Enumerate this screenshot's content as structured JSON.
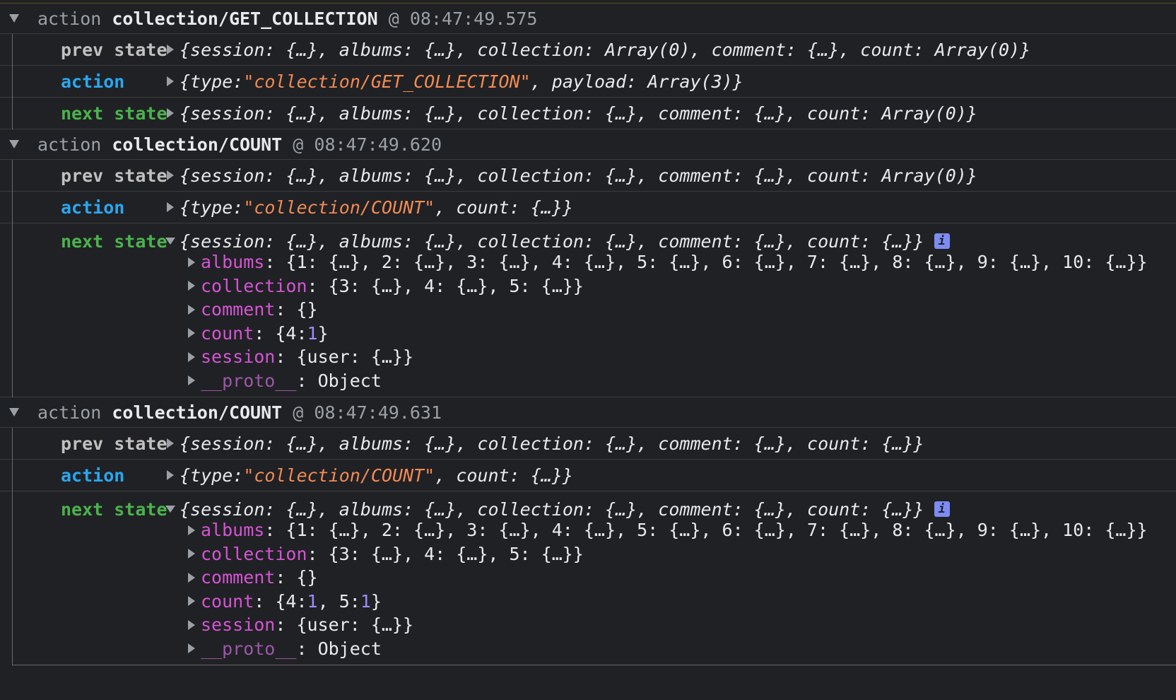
{
  "groups": [
    {
      "action_word": "action",
      "type": "collection/GET_COLLECTION",
      "at": "@",
      "time": "08:47:49.575",
      "prev_label": "prev state",
      "prev_value": "{session: {…}, albums: {…}, collection: Array(0), comment: {…}, count: Array(0)}",
      "action_label": "action",
      "action_value": {
        "pre": "{type: ",
        "str": "\"collection/GET_COLLECTION\"",
        "post": ", payload: Array(3)}"
      },
      "next_label": "next state",
      "next_value": "{session: {…}, albums: {…}, collection: {…}, comment: {…}, count: Array(0)}"
    },
    {
      "action_word": "action",
      "type": "collection/COUNT",
      "at": "@",
      "time": "08:47:49.620",
      "prev_label": "prev state",
      "prev_value": "{session: {…}, albums: {…}, collection: {…}, comment: {…}, count: Array(0)}",
      "action_label": "action",
      "action_value": {
        "pre": "{type: ",
        "str": "\"collection/COUNT\"",
        "post": ", count: {…}}"
      },
      "next_label": "next state",
      "next_value": "{session: {…}, albums: {…}, collection: {…}, comment: {…}, count: {…}}",
      "info_glyph": "i",
      "props": {
        "albums_key": "albums",
        "albums_val": ": {1: {…}, 2: {…}, 3: {…}, 4: {…}, 5: {…}, 6: {…}, 7: {…}, 8: {…}, 9: {…}, 10: {…}}",
        "collection_key": "collection",
        "collection_val": ": {3: {…}, 4: {…}, 5: {…}}",
        "comment_key": "comment",
        "comment_val": ": {}",
        "count_key": "count",
        "count_pre": ": {4: ",
        "count_n1": "1",
        "count_mid": "",
        "count_n2": "",
        "count_post": "}",
        "session_key": "session",
        "session_val": ": {user: {…}}",
        "proto_key": "__proto__",
        "proto_val": ": Object"
      }
    },
    {
      "action_word": "action",
      "type": "collection/COUNT",
      "at": "@",
      "time": "08:47:49.631",
      "prev_label": "prev state",
      "prev_value": "{session: {…}, albums: {…}, collection: {…}, comment: {…}, count: {…}}",
      "action_label": "action",
      "action_value": {
        "pre": "{type: ",
        "str": "\"collection/COUNT\"",
        "post": ", count: {…}}"
      },
      "next_label": "next state",
      "next_value": "{session: {…}, albums: {…}, collection: {…}, comment: {…}, count: {…}}",
      "info_glyph": "i",
      "props": {
        "albums_key": "albums",
        "albums_val": ": {1: {…}, 2: {…}, 3: {…}, 4: {…}, 5: {…}, 6: {…}, 7: {…}, 8: {…}, 9: {…}, 10: {…}}",
        "collection_key": "collection",
        "collection_val": ": {3: {…}, 4: {…}, 5: {…}}",
        "comment_key": "comment",
        "comment_val": ": {}",
        "count_key": "count",
        "count_pre": ": {4: ",
        "count_n1": "1",
        "count_mid": ", 5: ",
        "count_n2": "1",
        "count_post": "}",
        "session_key": "session",
        "session_val": ": {user: {…}}",
        "proto_key": "__proto__",
        "proto_val": ": Object"
      }
    }
  ],
  "colors": {
    "background": "#202124",
    "action_label": "#2aa6f0",
    "next_label": "#4ab34c",
    "string": "#f28b54",
    "property_key": "#d455d4",
    "number": "#9b8cff"
  }
}
